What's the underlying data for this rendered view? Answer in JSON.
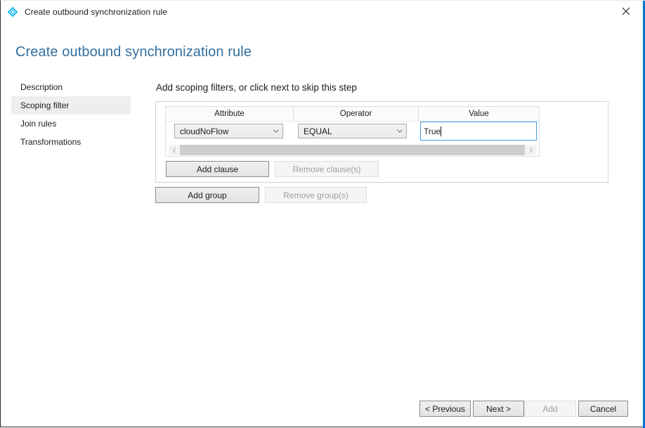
{
  "titlebar": {
    "icon": "sync-rule-diamond-icon",
    "title": "Create outbound synchronization rule",
    "close_label": "close-icon"
  },
  "page": {
    "title": "Create outbound synchronization rule",
    "title_color": "#336f9e"
  },
  "sidebar": {
    "items": [
      {
        "label": "Description",
        "selected": false
      },
      {
        "label": "Scoping filter",
        "selected": true
      },
      {
        "label": "Join rules",
        "selected": false
      },
      {
        "label": "Transformations",
        "selected": false
      }
    ]
  },
  "main": {
    "heading": "Add scoping filters, or click next to skip this step",
    "table": {
      "headers": [
        "Attribute",
        "Operator",
        "Value"
      ],
      "rows": [
        {
          "attribute": "cloudNoFlow",
          "operator": "EQUAL",
          "value": "True",
          "value_focused": true
        }
      ]
    },
    "scrollbar": {
      "left_arrow": "chevron-left-icon",
      "right_arrow": "chevron-right-icon",
      "orientation": "horizontal"
    },
    "clause_buttons": {
      "add": {
        "label": "Add clause",
        "enabled": true
      },
      "remove": {
        "label": "Remove clause(s)",
        "enabled": false
      }
    },
    "group_buttons": {
      "add": {
        "label": "Add group",
        "enabled": true
      },
      "remove": {
        "label": "Remove group(s)",
        "enabled": false
      }
    }
  },
  "footer": {
    "previous": {
      "label": "< Previous",
      "enabled": true
    },
    "next": {
      "label": "Next >",
      "enabled": true
    },
    "add": {
      "label": "Add",
      "enabled": false
    },
    "cancel": {
      "label": "Cancel",
      "enabled": true
    }
  },
  "colors": {
    "accent": "#0078d7",
    "icon": "#1ab5e8",
    "focus_border": "#4a9ada",
    "selection_bg": "#eeeeee"
  }
}
